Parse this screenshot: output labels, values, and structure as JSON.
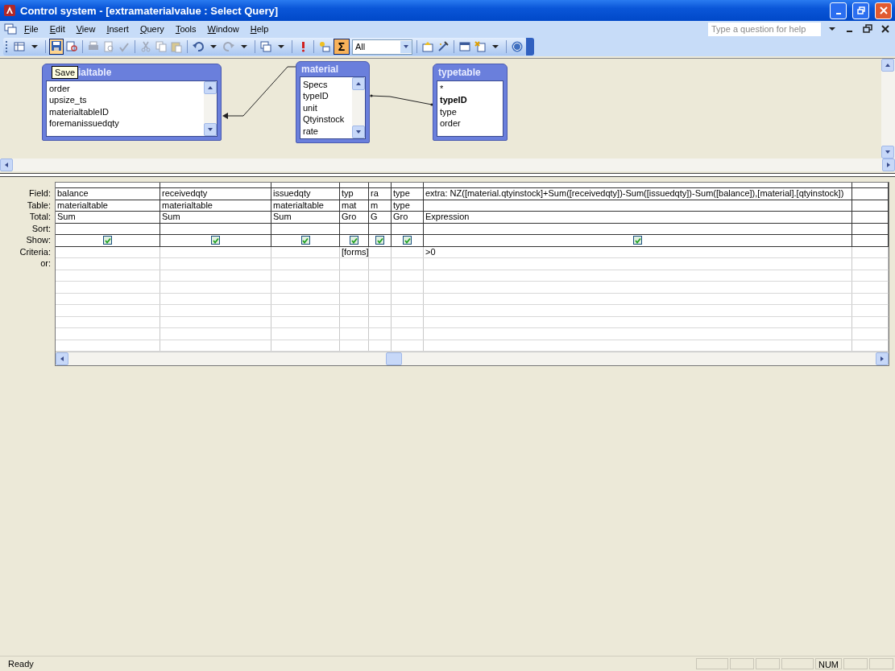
{
  "window": {
    "title": "Control system - [extramaterialvalue : Select Query]"
  },
  "menu": [
    "File",
    "Edit",
    "View",
    "Insert",
    "Query",
    "Tools",
    "Window",
    "Help"
  ],
  "help_box": {
    "placeholder": "Type a question for help"
  },
  "toolbar": {
    "totals": {
      "label": "Σ",
      "on": true
    },
    "view_filter": {
      "value": "All"
    },
    "tooltip": "Save"
  },
  "diagram": {
    "tables": [
      {
        "title": "ialtable",
        "fields": [
          {
            "name": "order",
            "bold": false
          },
          {
            "name": "upsize_ts",
            "bold": false
          },
          {
            "name": "materialtableID",
            "bold": false
          },
          {
            "name": "foremanissuedqty",
            "bold": false
          }
        ]
      },
      {
        "title": "material",
        "fields": [
          {
            "name": "Specs",
            "bold": false
          },
          {
            "name": "typeID",
            "bold": false
          },
          {
            "name": "unit",
            "bold": false
          },
          {
            "name": "Qtyinstock",
            "bold": false
          },
          {
            "name": "rate",
            "bold": false
          }
        ]
      },
      {
        "title": "typetable",
        "fields": [
          {
            "name": "*",
            "bold": false
          },
          {
            "name": "typeID",
            "bold": true
          },
          {
            "name": "type",
            "bold": false
          },
          {
            "name": "order",
            "bold": false
          }
        ]
      }
    ]
  },
  "grid": {
    "row_labels": [
      "Field:",
      "Table:",
      "Total:",
      "Sort:",
      "Show:",
      "Criteria:",
      "or:"
    ],
    "columns": [
      {
        "field": "balance",
        "table": "materialtable",
        "total": "Sum",
        "show": true
      },
      {
        "field": "receivedqty",
        "table": "materialtable",
        "total": "Sum",
        "show": true
      },
      {
        "field": "issuedqty",
        "table": "materialtable",
        "total": "Sum",
        "show": true
      },
      {
        "field": "typ",
        "table": "mat",
        "total": "Gro",
        "show": true,
        "criteria": "[forms]"
      },
      {
        "field": "ra",
        "table": "m",
        "total": "G",
        "show": true
      },
      {
        "field": "type",
        "table": "type",
        "total": "Gro",
        "show": true
      },
      {
        "field": "extra: NZ([material.qtyinstock]+Sum([receivedqty])-Sum([issuedqty])-Sum([balance]),[material].[qtyinstock])",
        "total": "Expression",
        "show": true,
        "criteria": ">0"
      }
    ]
  },
  "status_bar": {
    "message": "Ready",
    "indicators": [
      "NUM"
    ]
  }
}
